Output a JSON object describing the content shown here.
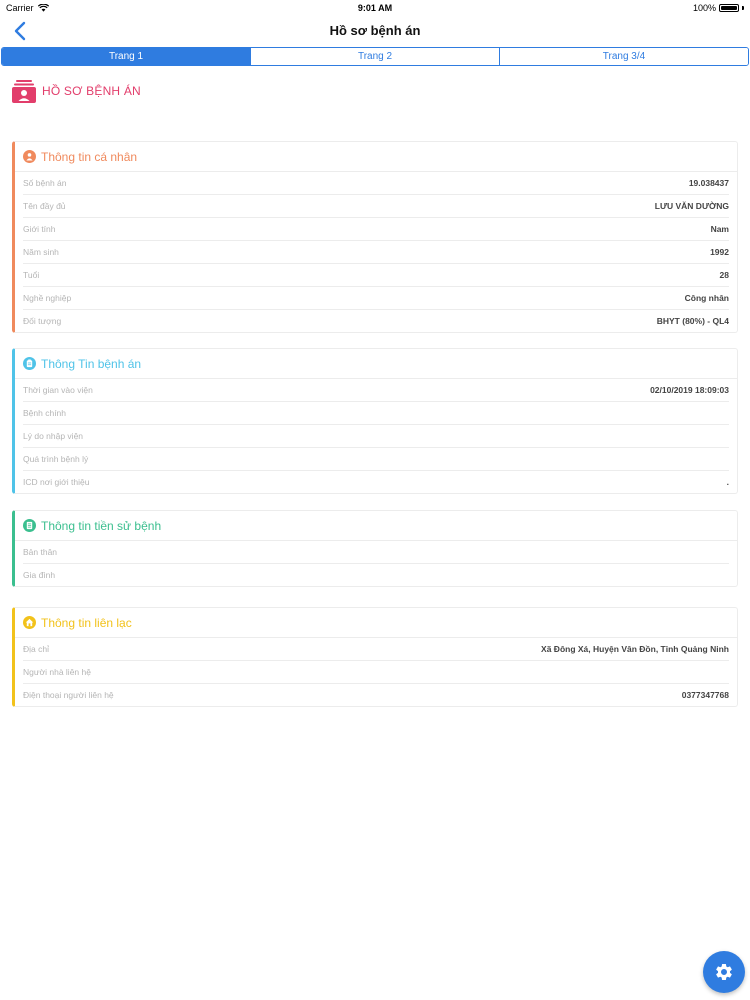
{
  "status_bar": {
    "carrier": "Carrier",
    "time": "9:01 AM",
    "battery": "100%"
  },
  "nav": {
    "title": "Hồ sơ bệnh án"
  },
  "tabs": [
    {
      "label": "Trang 1",
      "active": true
    },
    {
      "label": "Trang 2",
      "active": false
    },
    {
      "label": "Trang 3/4",
      "active": false
    }
  ],
  "record_title": "HỒ SƠ BỆNH ÁN",
  "colors": {
    "accent": "#2f7ce0",
    "record": "#e23d6b",
    "personal": "#f08a5d",
    "medical": "#4fc3e8",
    "history": "#3bbf8f",
    "contact": "#f2c21b"
  },
  "sections": {
    "personal": {
      "title": "Thông tin cá nhân",
      "icon": "person-icon",
      "rows": [
        {
          "label": "Số bệnh án",
          "value": "19.038437"
        },
        {
          "label": "Tên đầy đủ",
          "value": "LƯU VĂN DƯỜNG"
        },
        {
          "label": "Giới tính",
          "value": "Nam"
        },
        {
          "label": "Năm sinh",
          "value": "1992"
        },
        {
          "label": "Tuổi",
          "value": "28"
        },
        {
          "label": "Nghề nghiệp",
          "value": "Công nhân"
        },
        {
          "label": "Đối tượng",
          "value": "BHYT (80%) - QL4"
        }
      ]
    },
    "medical": {
      "title": "Thông Tin bệnh án",
      "icon": "clipboard-icon",
      "rows": [
        {
          "label": "Thời gian vào viện",
          "value": "02/10/2019 18:09:03"
        },
        {
          "label": "Bệnh chính",
          "value": ""
        },
        {
          "label": "Lý do nhập viện",
          "value": ""
        },
        {
          "label": "Quá trình bệnh lý",
          "value": ""
        },
        {
          "label": "ICD nơi giới thiệu",
          "value": "."
        }
      ]
    },
    "history": {
      "title": "Thông tin tiền sử bệnh",
      "icon": "list-icon",
      "rows": [
        {
          "label": "Bản thân",
          "value": ""
        },
        {
          "label": "Gia đình",
          "value": ""
        }
      ]
    },
    "contact": {
      "title": "Thông tin liên lạc",
      "icon": "home-icon",
      "rows": [
        {
          "label": "Địa chỉ",
          "value": "Xã Đông Xá, Huyện Vân Đồn, Tỉnh Quảng Ninh"
        },
        {
          "label": "Người nhà liên hệ",
          "value": ""
        },
        {
          "label": "Điện thoại người liên hệ",
          "value": "0377347768"
        }
      ]
    }
  },
  "fab": {
    "icon": "gear-icon"
  }
}
